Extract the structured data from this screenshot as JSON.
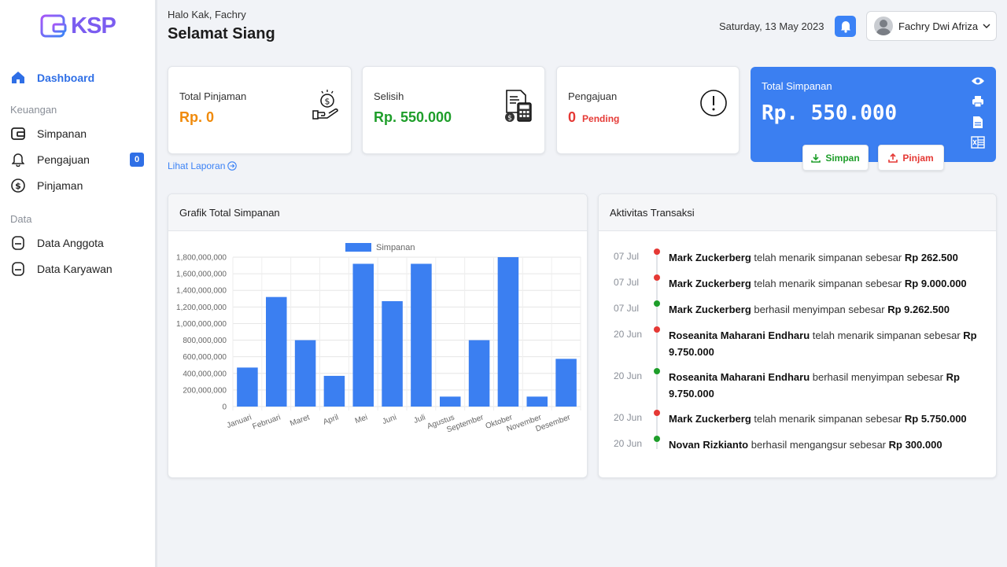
{
  "app": {
    "brand": "KSP",
    "brand_color": "#7b5cf0",
    "accent": "#3b82f6"
  },
  "sidebar": {
    "dashboard": "Dashboard",
    "section_keuangan": "Keuangan",
    "simpanan": "Simpanan",
    "pengajuan": "Pengajuan",
    "pengajuan_badge": "0",
    "pinjaman": "Pinjaman",
    "section_data": "Data",
    "data_anggota": "Data Anggota",
    "data_karyawan": "Data Karyawan"
  },
  "header": {
    "greeting_small": "Halo Kak, Fachry",
    "greeting_big": "Selamat Siang",
    "date": "Saturday, 13 May 2023",
    "user_name": "Fachry Dwi Afriza"
  },
  "stats": {
    "total_pinjaman_label": "Total Pinjaman",
    "total_pinjaman_value": "Rp. 0",
    "selisih_label": "Selisih",
    "selisih_value": "Rp. 550.000",
    "pengajuan_label": "Pengajuan",
    "pengajuan_count": "0",
    "pengajuan_status": "Pending",
    "link_laporan": "Lihat Laporan"
  },
  "simpanan_card": {
    "label": "Total Simpanan",
    "value": "Rp. 550.000",
    "btn_simpan": "Simpan",
    "btn_pinjam": "Pinjam"
  },
  "chart_panel": {
    "title": "Grafik Total Simpanan"
  },
  "chart_data": {
    "type": "bar",
    "title": "",
    "xlabel": "",
    "ylabel": "",
    "categories": [
      "Januari",
      "Februari",
      "Maret",
      "April",
      "Mei",
      "Juni",
      "Juli",
      "Agustus",
      "September",
      "Oktober",
      "November",
      "Desember"
    ],
    "series": [
      {
        "name": "Simpanan",
        "color": "#3b7ff1",
        "values": [
          470000000,
          1320000000,
          800000000,
          370000000,
          1720000000,
          1270000000,
          1720000000,
          120000000,
          800000000,
          1800000000,
          120000000,
          575000000
        ]
      }
    ],
    "ylim": [
      0,
      1800000000
    ],
    "yticks": [
      "0",
      "200,000,000",
      "400,000,000",
      "600,000,000",
      "800,000,000",
      "1,000,000,000",
      "1,200,000,000",
      "1,400,000,000",
      "1,600,000,000",
      "1,800,000,000"
    ],
    "grid": true,
    "legend": "top"
  },
  "activity": {
    "title": "Aktivitas Transaksi",
    "items": [
      {
        "date": "07 Jul",
        "color": "#e53935",
        "name": "Mark Zuckerberg",
        "action": " telah menarik simpanan sebesar ",
        "amount": "Rp 262.500"
      },
      {
        "date": "07 Jul",
        "color": "#e53935",
        "name": "Mark Zuckerberg",
        "action": " telah menarik simpanan sebesar ",
        "amount": "Rp 9.000.000"
      },
      {
        "date": "07 Jul",
        "color": "#1e9e2a",
        "name": "Mark Zuckerberg",
        "action": " berhasil menyimpan sebesar ",
        "amount": "Rp 9.262.500"
      },
      {
        "date": "20 Jun",
        "color": "#e53935",
        "name": "Roseanita Maharani Endharu",
        "action": " telah menarik simpanan sebesar ",
        "amount": "Rp 9.750.000"
      },
      {
        "date": "20 Jun",
        "color": "#1e9e2a",
        "name": "Roseanita Maharani Endharu",
        "action": " berhasil menyimpan sebesar ",
        "amount": "Rp 9.750.000"
      },
      {
        "date": "20 Jun",
        "color": "#e53935",
        "name": "Mark Zuckerberg",
        "action": " telah menarik simpanan sebesar ",
        "amount": "Rp 5.750.000"
      },
      {
        "date": "20 Jun",
        "color": "#1e9e2a",
        "name": "Novan Rizkianto",
        "action": " berhasil mengangsur sebesar ",
        "amount": "Rp 300.000"
      }
    ]
  }
}
